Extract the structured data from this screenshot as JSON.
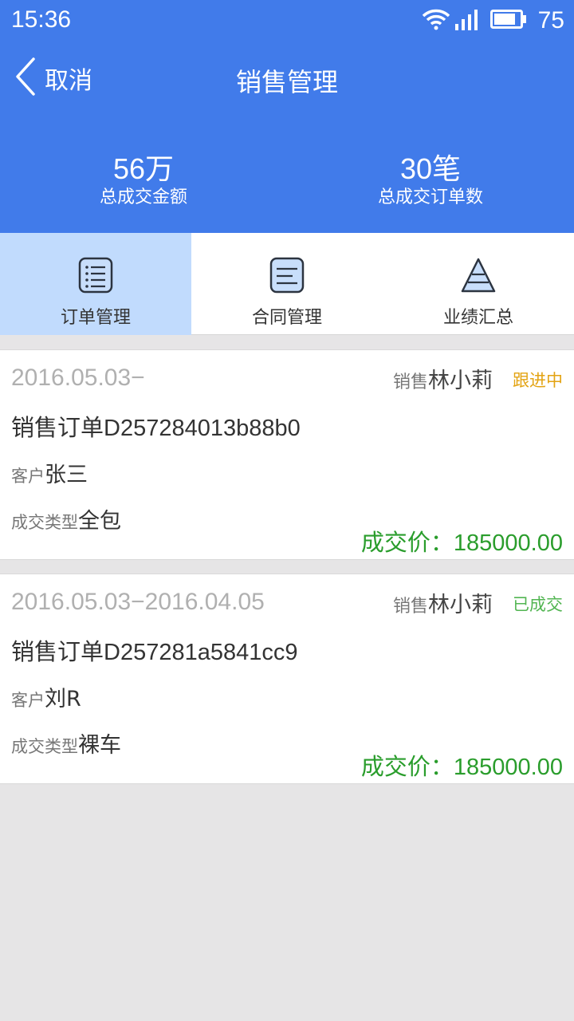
{
  "status_bar": {
    "time": "15:36",
    "battery": "75"
  },
  "nav": {
    "back_label": "取消",
    "title": "销售管理"
  },
  "stats": {
    "total_amount": "56万",
    "total_amount_label": "总成交金额",
    "total_orders": "30笔",
    "total_orders_label": "总成交订单数"
  },
  "tabs": [
    {
      "label": "订单管理",
      "icon": "list-icon",
      "active": true
    },
    {
      "label": "合同管理",
      "icon": "document-icon",
      "active": false
    },
    {
      "label": "业绩汇总",
      "icon": "pyramid-icon",
      "active": false
    }
  ],
  "orders": [
    {
      "date": "2016.05.03−",
      "seller_label": "销售",
      "seller": "林小莉",
      "status": "跟进中",
      "status_color": "#e3a312",
      "order_no": "销售订单D257284013b88b0",
      "customer_label": "客户",
      "customer": "张三",
      "type_label": "成交类型",
      "type": "全包",
      "price_label": "成交价：",
      "price": "185000.00"
    },
    {
      "date": "2016.05.03−2016.04.05",
      "seller_label": "销售",
      "seller": "林小莉",
      "status": "已成交",
      "status_color": "#52b552",
      "order_no": "销售订单D257281a5841cc9",
      "customer_label": "客户",
      "customer": "刘R",
      "type_label": "成交类型",
      "type": "裸车",
      "price_label": "成交价：",
      "price": "185000.00"
    }
  ],
  "colors": {
    "header_bg": "#417bea",
    "active_tab_bg": "#c1dbfd",
    "price_green": "#2a9d2c"
  }
}
